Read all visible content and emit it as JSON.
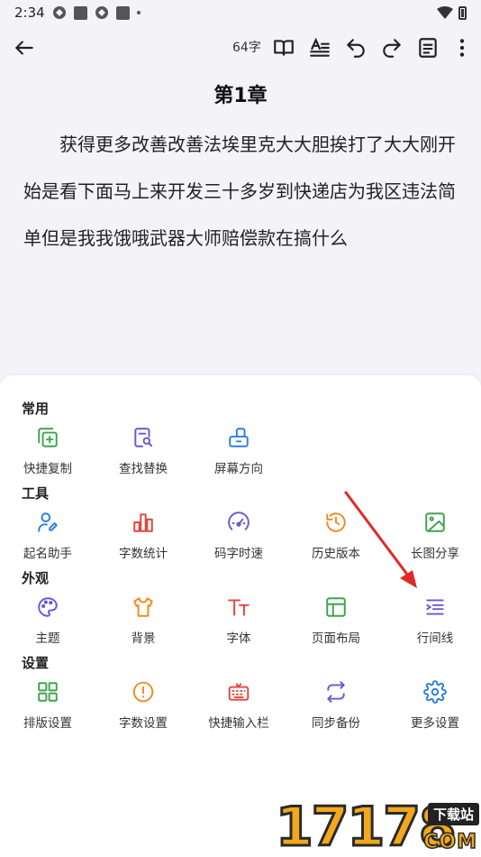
{
  "status_bar": {
    "time": "2:34"
  },
  "toolbar": {
    "word_count": "64字"
  },
  "editor": {
    "chapter_title": "第1章",
    "content": "获得更多改善改善法埃里克大大胆挨打了大大刚开始是看下面马上来开发三十多岁到快递店为我区违法简单但是我我饿哦武器大师赔偿款在搞什么"
  },
  "sheet": {
    "sections": {
      "common": {
        "title": "常用",
        "items": [
          "快捷复制",
          "查找替换",
          "屏幕方向"
        ]
      },
      "tools": {
        "title": "工具",
        "items": [
          "起名助手",
          "字数统计",
          "码字时速",
          "历史版本",
          "长图分享"
        ]
      },
      "appearance": {
        "title": "外观",
        "items": [
          "主题",
          "背景",
          "字体",
          "页面布局",
          "行间线"
        ]
      },
      "settings": {
        "title": "设置",
        "items": [
          "排版设置",
          "字数设置",
          "快捷输入栏",
          "同步备份",
          "更多设置"
        ]
      }
    }
  },
  "colors": {
    "green": "#3fa34d",
    "purple": "#6b56d6",
    "blue": "#2f7fdc",
    "red": "#e0463c",
    "orange": "#f28a24",
    "arrow": "#e02a25"
  },
  "watermark": {
    "digits": "17178",
    "tag": "下载站",
    "suffix": "COM"
  }
}
